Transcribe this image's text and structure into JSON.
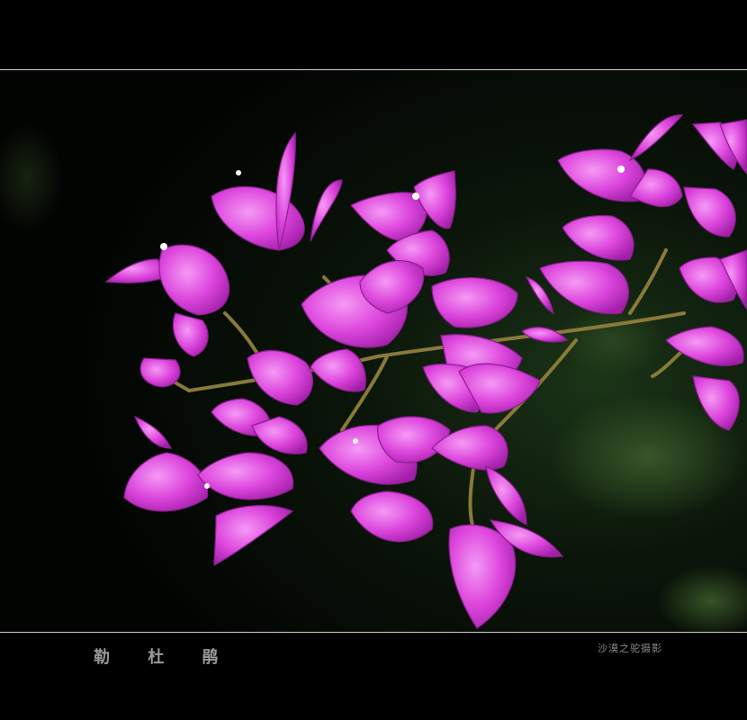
{
  "caption": {
    "title": "勒 杜 鹃",
    "credit": "沙漠之驼摄影"
  },
  "photo": {
    "subject": "bougainvillea-branch",
    "colors": {
      "background": "#000000",
      "bract": "#d83bd8",
      "bract_light": "#ef7cf0",
      "vein": "#8a1f8f",
      "stem": "#8a7a3a",
      "foliage_blur": "#1f3a1a"
    }
  }
}
